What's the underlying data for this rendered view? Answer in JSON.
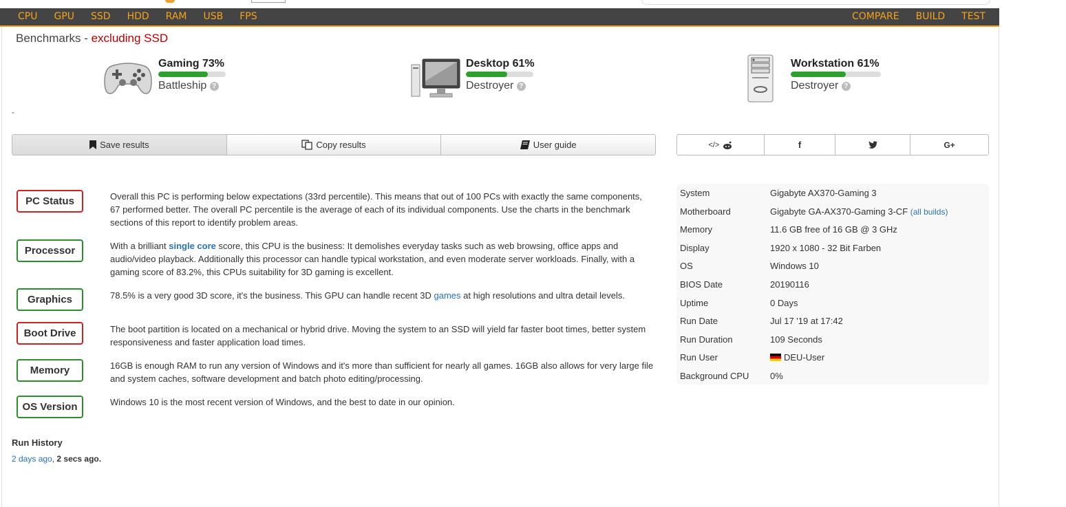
{
  "nav": {
    "left": [
      "CPU",
      "GPU",
      "SSD",
      "HDD",
      "RAM",
      "USB",
      "FPS"
    ],
    "right": [
      "COMPARE",
      "BUILD",
      "TEST"
    ],
    "bar_color": "#444444",
    "accent": "#f7a21b"
  },
  "benchmarks": {
    "title": "Benchmarks",
    "separator": " - ",
    "exclusion": "excluding SSD",
    "gaming": {
      "label": "Gaming 73%",
      "percent": 73,
      "tier": "Battleship"
    },
    "desktop": {
      "label": "Desktop 61%",
      "percent": 61,
      "tier": "Destroyer"
    },
    "workstation": {
      "label": "Workstation 61%",
      "percent": 61,
      "tier": "Destroyer"
    },
    "help_glyph": "?"
  },
  "dash": "-",
  "actions": {
    "save": "Save results",
    "copy": "Copy results",
    "guide": "User guide"
  },
  "share": {
    "icons": [
      "embed-reddit-icon",
      "facebook-icon",
      "twitter-icon",
      "google-plus-icon"
    ],
    "embed": "</>",
    "facebook": "f",
    "google": "G+"
  },
  "status": {
    "pc_status": {
      "label": "PC Status",
      "level": "bad",
      "text": "Overall this PC is performing below expectations (33rd percentile). This means that out of 100 PCs with exactly the same components, 67 performed better. The overall PC percentile is the average of each of its individual components. Use the charts in the benchmark sections of this report to identify problem areas."
    },
    "processor": {
      "label": "Processor",
      "level": "good",
      "text_before": "With a brilliant ",
      "link": "single core",
      "text_after": " score, this CPU is the business: It demolishes everyday tasks such as web browsing, office apps and audio/video playback. Additionally this processor can handle typical workstation, and even moderate server workloads. Finally, with a gaming score of 83.2%, this CPUs suitability for 3D gaming is excellent."
    },
    "graphics": {
      "label": "Graphics",
      "level": "good",
      "text_before": "78.5% is a very good 3D score, it's the business. This GPU can handle recent 3D ",
      "link": "games",
      "text_after": " at high resolutions and ultra detail levels."
    },
    "boot_drive": {
      "label": "Boot Drive",
      "level": "bad",
      "text": "The boot partition is located on a mechanical or hybrid drive. Moving the system to an SSD will yield far faster boot times, better system responsiveness and faster application load times."
    },
    "memory": {
      "label": "Memory",
      "level": "good",
      "text": "16GB is enough RAM to run any version of Windows and it's more than sufficient for nearly all games. 16GB also allows for very large file and system caches, software development and batch photo editing/processing."
    },
    "os_version": {
      "label": "OS Version",
      "level": "good",
      "text": "Windows 10 is the most recent version of Windows, and the best to date in our opinion."
    },
    "colors": {
      "bad": "#cc2222",
      "good": "#2e8b2e"
    }
  },
  "system": {
    "rows": [
      {
        "key": "System",
        "value": "Gigabyte AX370-Gaming 3"
      },
      {
        "key": "Motherboard",
        "value": "Gigabyte GA-AX370-Gaming 3-CF",
        "link": "(all builds)"
      },
      {
        "key": "Memory",
        "value": "11.6 GB free of 16 GB @ 3 GHz"
      },
      {
        "key": "Display",
        "value": "1920 x 1080 - 32 Bit Farben"
      },
      {
        "key": "OS",
        "value": "Windows 10"
      },
      {
        "key": "BIOS Date",
        "value": "20190116"
      },
      {
        "key": "Uptime",
        "value": "0 Days"
      },
      {
        "key": "Run Date",
        "value": "Jul 17 '19 at 17:42"
      },
      {
        "key": "Run Duration",
        "value": "109 Seconds"
      },
      {
        "key": "Run User",
        "value": "DEU-User",
        "flag": "germany-flag-icon"
      },
      {
        "key": "Background CPU",
        "value": "0%"
      }
    ]
  },
  "run_history": {
    "title": "Run History",
    "first": "2 days ago",
    "separator": ", ",
    "current": "2 secs ago."
  }
}
